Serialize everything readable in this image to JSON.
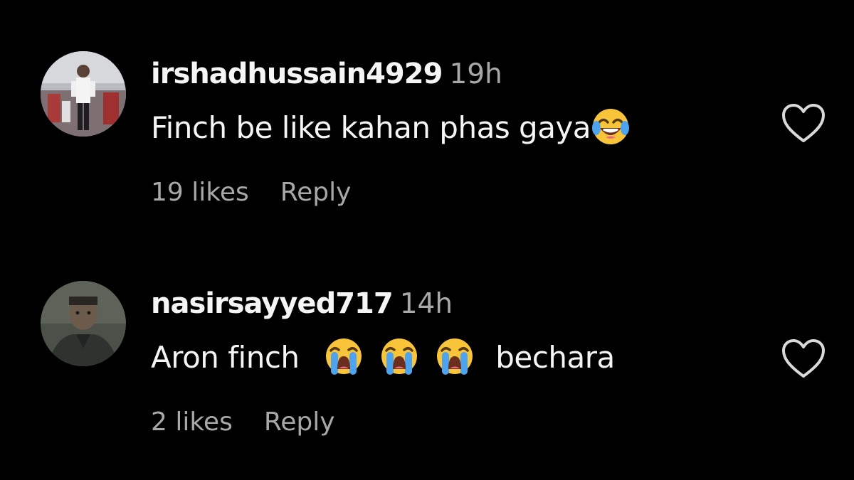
{
  "comments": [
    {
      "username": "irshadhussain4929",
      "time": "19h",
      "text": "Finch be like kahan phas gaya",
      "emojis": [
        "face-with-tears-of-joy"
      ],
      "likes": "19 likes",
      "reply": "Reply"
    },
    {
      "username": "nasirsayyed717",
      "time": "14h",
      "text_before": "Aron finch",
      "emojis": [
        "loudly-crying-face",
        "loudly-crying-face",
        "loudly-crying-face"
      ],
      "text_after": "bechara",
      "likes": "2 likes",
      "reply": "Reply"
    }
  ],
  "colors": {
    "background": "#000000",
    "primary_text": "#f5f5f5",
    "secondary_text": "#a8a8a8"
  },
  "icons": {
    "like": "heart-outline-icon"
  }
}
